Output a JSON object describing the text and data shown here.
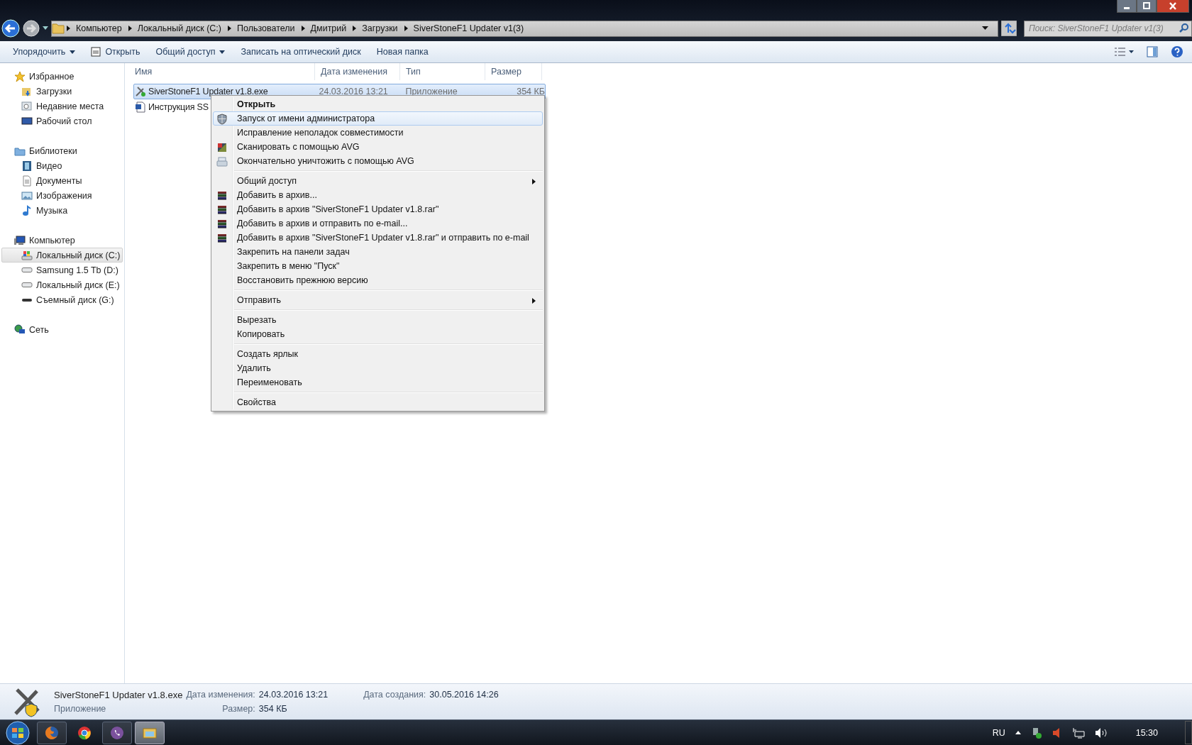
{
  "address_bar": {
    "breadcrumbs": [
      "Компьютер",
      "Локальный диск (C:)",
      "Пользователи",
      "Дмитрий",
      "Загрузки",
      "SiverStoneF1 Updater v1(3)"
    ]
  },
  "search": {
    "placeholder": "Поиск: SiverStoneF1 Updater v1(3)"
  },
  "toolbar": {
    "buttons": [
      {
        "label": "Упорядочить",
        "kind": "dropdown"
      },
      {
        "label": "Открыть",
        "kind": "icon"
      },
      {
        "label": "Общий доступ",
        "kind": "dropdown"
      },
      {
        "label": "Записать на оптический диск",
        "kind": "plain"
      },
      {
        "label": "Новая папка",
        "kind": "plain"
      }
    ]
  },
  "nav_pane": {
    "groups": [
      {
        "label": "Избранное",
        "kind": "star",
        "selected": false,
        "children": [
          {
            "label": "Загрузки",
            "kind": "downloads",
            "selected": false
          },
          {
            "label": "Недавние места",
            "kind": "recent",
            "selected": false
          },
          {
            "label": "Рабочий стол",
            "kind": "desktop",
            "selected": false
          }
        ]
      },
      {
        "label": "Библиотеки",
        "kind": "library",
        "selected": false,
        "children": [
          {
            "label": "Видео",
            "kind": "video",
            "selected": false
          },
          {
            "label": "Документы",
            "kind": "docs",
            "selected": false
          },
          {
            "label": "Изображения",
            "kind": "images",
            "selected": false
          },
          {
            "label": "Музыка",
            "kind": "music",
            "selected": false
          }
        ]
      },
      {
        "label": "Компьютер",
        "kind": "computer",
        "selected": false,
        "children": [
          {
            "label": "Локальный диск (C:)",
            "kind": "system_drive",
            "selected": true
          },
          {
            "label": "Samsung 1.5 Tb (D:)",
            "kind": "drive",
            "selected": false
          },
          {
            "label": "Локальный диск (E:)",
            "kind": "drive",
            "selected": false
          },
          {
            "label": "Съемный диск (G:)",
            "kind": "removable",
            "selected": false
          }
        ]
      },
      {
        "label": "Сеть",
        "kind": "network",
        "selected": false
      }
    ]
  },
  "file_list": {
    "columns": [
      "Имя",
      "Дата изменения",
      "Тип",
      "Размер"
    ],
    "rows": [
      {
        "kind": "exe",
        "name": "SiverStoneF1 Updater v1.8.exe",
        "date": "24.03.2016 13:21",
        "type": "Приложение",
        "size": "354 КБ",
        "selected": true
      },
      {
        "kind": "doc",
        "name": "Инструкция SS",
        "selected": false
      }
    ]
  },
  "context_menu": {
    "items": [
      {
        "kind": "default",
        "label": "Открыть",
        "selected": false
      },
      {
        "kind": "shield",
        "label": "Запуск от имени администратора",
        "selected": true
      },
      {
        "kind": "plain",
        "label": "Исправление неполадок совместимости",
        "selected": false
      },
      {
        "kind": "scan",
        "label": "Сканировать с помощью AVG",
        "selected": false
      },
      {
        "kind": "shred",
        "label": "Окончательно уничтожить с помощью AVG",
        "selected": false
      },
      {
        "kind": "separator"
      },
      {
        "kind": "submenu",
        "label": "Общий доступ",
        "selected": false
      },
      {
        "kind": "archive",
        "label": "Добавить в архив...",
        "selected": false
      },
      {
        "kind": "archive",
        "label": "Добавить в архив \"SiverStoneF1 Updater v1.8.rar\"",
        "selected": false
      },
      {
        "kind": "archive",
        "label": "Добавить в архив и отправить по e-mail...",
        "selected": false
      },
      {
        "kind": "archive",
        "label": "Добавить в архив \"SiverStoneF1 Updater v1.8.rar\" и отправить по e-mail",
        "selected": false
      },
      {
        "kind": "plain",
        "label": "Закрепить на панели задач",
        "selected": false
      },
      {
        "kind": "plain",
        "label": "Закрепить в меню \"Пуск\"",
        "selected": false
      },
      {
        "kind": "plain",
        "label": "Восстановить прежнюю версию",
        "selected": false
      },
      {
        "kind": "separator"
      },
      {
        "kind": "submenu",
        "label": "Отправить",
        "selected": false
      },
      {
        "kind": "separator"
      },
      {
        "kind": "plain",
        "label": "Вырезать",
        "selected": false
      },
      {
        "kind": "plain",
        "label": "Копировать",
        "selected": false
      },
      {
        "kind": "separator"
      },
      {
        "kind": "plain",
        "label": "Создать ярлык",
        "selected": false
      },
      {
        "kind": "plain",
        "label": "Удалить",
        "selected": false
      },
      {
        "kind": "plain",
        "label": "Переименовать",
        "selected": false
      },
      {
        "kind": "separator"
      },
      {
        "kind": "plain",
        "label": "Свойства",
        "selected": false
      }
    ]
  },
  "details": {
    "name": "SiverStoneF1 Updater v1.8.exe",
    "type": "Приложение",
    "fields": [
      {
        "label": "Дата изменения:",
        "value": "24.03.2016 13:21"
      },
      {
        "label": "Размер:",
        "value": "354 КБ"
      },
      {
        "label": "Дата создания:",
        "value": "30.05.2016 14:26"
      }
    ]
  },
  "taskbar": {
    "apps": [
      {
        "kind": "firefox",
        "running": true,
        "selected": false
      },
      {
        "kind": "chrome",
        "running": false,
        "selected": false
      },
      {
        "kind": "viber",
        "running": true,
        "selected": false
      },
      {
        "kind": "explorer",
        "running": true,
        "selected": true
      }
    ],
    "language": "RU",
    "clock": "15:30"
  }
}
